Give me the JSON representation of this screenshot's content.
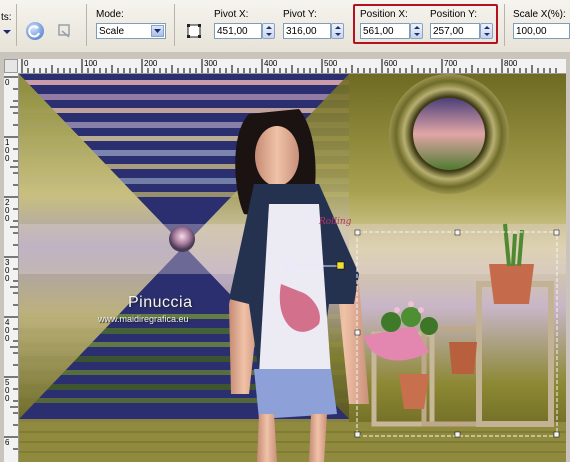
{
  "toolbar": {
    "presets_label": "ts:",
    "mode_label": "Mode:",
    "mode_value": "Scale",
    "pivot_x_label": "Pivot X:",
    "pivot_x_value": "451,00",
    "pivot_y_label": "Pivot Y:",
    "pivot_y_value": "316,00",
    "position_x_label": "Position X:",
    "position_x_value": "561,00",
    "position_y_label": "Position Y:",
    "position_y_value": "257,00",
    "scale_x_label": "Scale X(%):",
    "scale_x_value": "100,00"
  },
  "ruler": {
    "top_ticks": [
      "0",
      "100",
      "200",
      "300",
      "400",
      "500",
      "600",
      "700",
      "800"
    ],
    "left_ticks": [
      "0",
      "1\n0\n0",
      "2\n0\n0",
      "3\n0\n0",
      "4\n0\n0",
      "5\n0\n0",
      "6"
    ]
  },
  "canvas": {
    "watermark_name": "Pinuccia",
    "watermark_url": "www.maidiregrafica.eu",
    "shirt_text": "Rolling"
  }
}
